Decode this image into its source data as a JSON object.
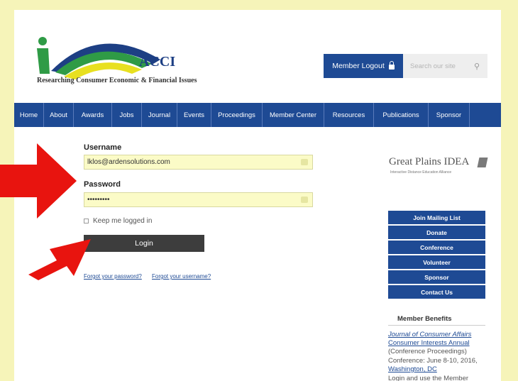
{
  "header": {
    "logo_text": "ACCI",
    "tagline": "Researching Consumer Economic & Financial Issues",
    "logout_label": "Member Logout",
    "search_placeholder": "Search our site"
  },
  "nav": {
    "items": [
      "Home",
      "About",
      "Awards",
      "Jobs",
      "Journal",
      "Events",
      "Proceedings",
      "Member Center",
      "Resources",
      "Publications",
      "Sponsor"
    ]
  },
  "login": {
    "username_label": "Username",
    "username_value": "lklos@ardensolutions.com",
    "password_label": "Password",
    "password_value": "•••••••••",
    "keep_logged_in": "Keep me logged in",
    "login_button": "Login",
    "forgot_password": "Forgot your password?",
    "forgot_username": "Forgot your username?"
  },
  "sidebar": {
    "partner_title": "Great Plains IDEA",
    "partner_subtitle": "Interactive Distance Education Alliance",
    "buttons": [
      "Join Mailing List",
      "Donate",
      "Conference",
      "Volunteer",
      "Sponsor",
      "Contact Us"
    ],
    "member_benefits_title": "Member Benefits",
    "benefits": {
      "journal": "Journal of Consumer Affairs",
      "annual": "Consumer Interests Annual",
      "proceedings": "(Conference Proceedings)",
      "conference": "Conference: June 8-10, 2016,",
      "location": "Washington, DC",
      "cut_off": "Login and use the Member"
    }
  },
  "colors": {
    "page_background": "#f6f4b9",
    "brand_blue": "#1e4a94",
    "login_button": "#3d3d3d",
    "input_fill": "#fbfbc7",
    "arrow_red": "#e8140f"
  }
}
